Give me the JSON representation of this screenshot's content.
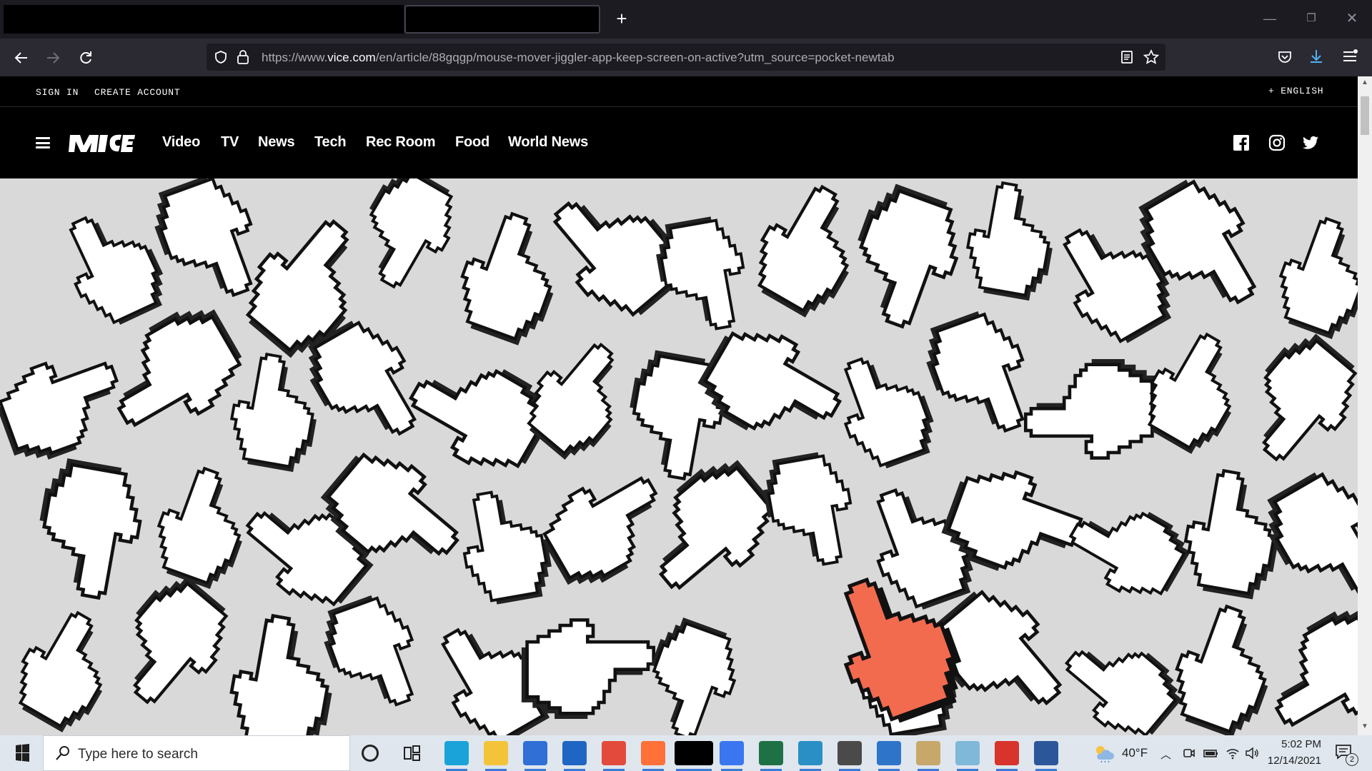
{
  "browser": {
    "url_prefix": "https://www.",
    "url_host": "vice.com",
    "url_path": "/en/article/88gqgp/mouse-mover-jiggler-app-keep-screen-on-active?utm_source=pocket-newtab",
    "new_tab_symbol": "+",
    "window_controls": {
      "minimize": "—",
      "restore": "❐",
      "close": "✕"
    }
  },
  "page": {
    "topbar": {
      "sign_in": "SIGN IN",
      "create_account": "CREATE ACCOUNT",
      "language": "+ ENGLISH"
    },
    "nav": {
      "logo": "VICE",
      "links": [
        "Video",
        "TV",
        "News",
        "Tech",
        "Rec Room",
        "Food",
        "World News"
      ]
    },
    "social": [
      "facebook-icon",
      "instagram-icon",
      "twitter-icon"
    ],
    "hero": {
      "description_colors": {
        "background": "#d9d9d9",
        "cursor_fill": "#ffffff",
        "cursor_outline": "#111111",
        "accent_cursor": "#f26b4f"
      }
    }
  },
  "taskbar": {
    "search_placeholder": "Type here to search",
    "apps": [
      "edge-icon",
      "file-explorer-icon",
      "store-icon",
      "mail-icon",
      "chrome-icon",
      "firefox-icon",
      "blank-window",
      "signal-icon",
      "excel-icon",
      "edge-dev-icon",
      "terminal-icon",
      "remote-desktop-icon",
      "paint-icon",
      "notes-icon",
      "acrobat-icon",
      "word-icon"
    ],
    "temperature": "40°F",
    "time": "5:02 PM",
    "date": "12/14/2021",
    "notification_count": "2"
  }
}
